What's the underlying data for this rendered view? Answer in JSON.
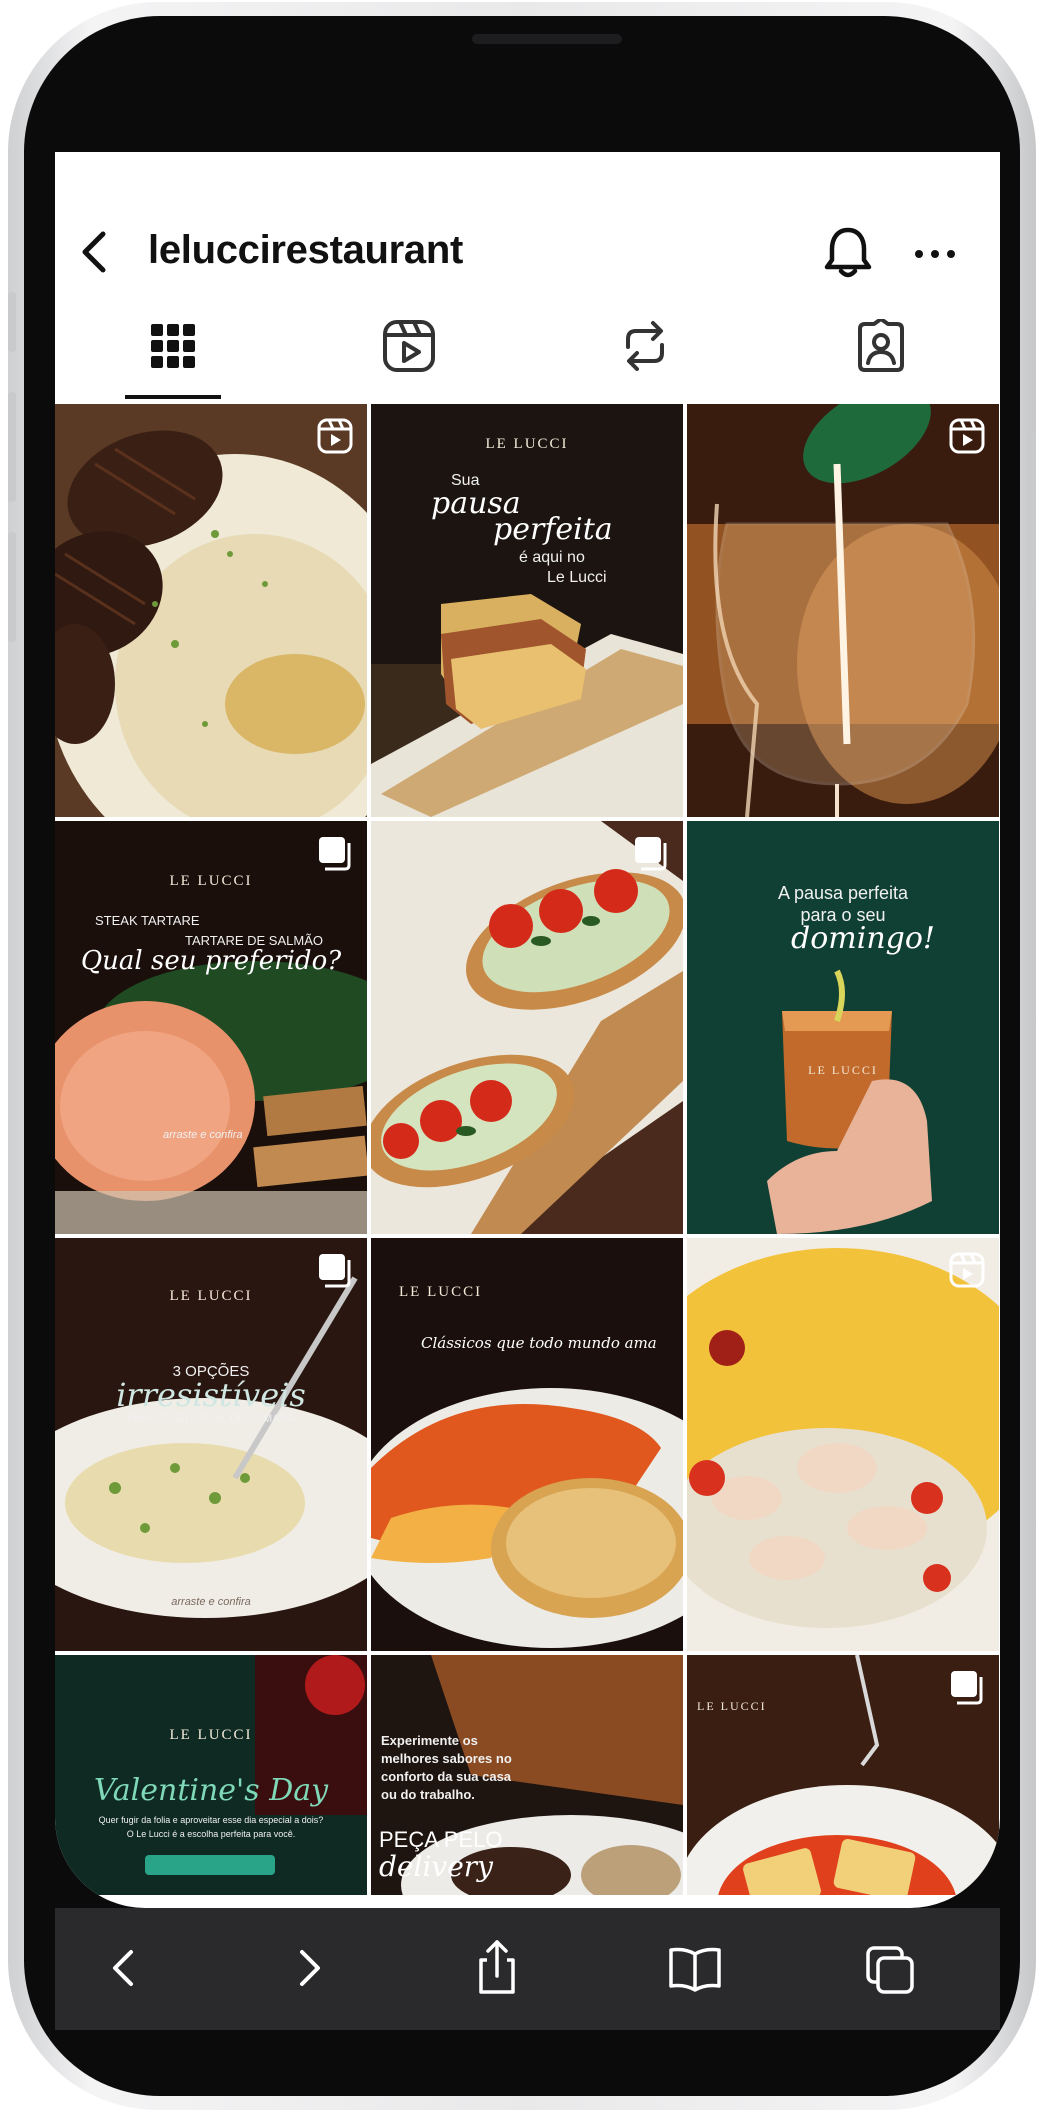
{
  "profile": {
    "username": "leluccirestaurant"
  },
  "icons": {
    "back": "chevron-left-icon",
    "bell": "bell-icon",
    "more": "more-horizontal-icon"
  },
  "tabs": [
    {
      "name": "posts-grid",
      "icon": "grid-icon",
      "selected": true
    },
    {
      "name": "reels",
      "icon": "reels-icon",
      "selected": false
    },
    {
      "name": "reposts",
      "icon": "repost-icon",
      "selected": false
    },
    {
      "name": "tagged",
      "icon": "tagged-icon",
      "selected": false
    }
  ],
  "posts": [
    {
      "type": "reel",
      "subject": "steak with risotto"
    },
    {
      "type": "post",
      "brand": "LE LUCCI",
      "line1": "Sua",
      "line2": "pausa",
      "line3": "perfeita",
      "line4": "é aqui no",
      "line5": "Le Lucci"
    },
    {
      "type": "reel",
      "subject": "white wine pour"
    },
    {
      "type": "carousel",
      "brand": "LE LUCCI",
      "line1": "STEAK TARTARE",
      "line2": "TARTARE DE SALMÃO",
      "line3": "Qual seu preferido?",
      "line4": "arraste e confira"
    },
    {
      "type": "carousel",
      "subject": "bruschetta"
    },
    {
      "type": "post",
      "brand": "LE LUCCI",
      "line1": "A pausa perfeita",
      "line2": "para o seu",
      "line3": "domingo!"
    },
    {
      "type": "carousel",
      "brand": "LE LUCCI",
      "line1": "3 OPÇÕES",
      "line2": "irresistíveis",
      "line3": "PARA O SEU FINAL DE SEMANA",
      "line4": "arraste e confira"
    },
    {
      "type": "post",
      "brand": "LE LUCCI",
      "line1": "Clássicos que todo mundo ama"
    },
    {
      "type": "reel",
      "subject": "seafood on polenta"
    },
    {
      "type": "post",
      "brand": "LE LUCCI",
      "line1": "Valentine's Day",
      "line2": "Quer fugir da folia e aproveitar esse dia especial a dois?",
      "line3": "O Le Lucci é a escolha perfeita para você."
    },
    {
      "type": "post",
      "line1": "Experimente os",
      "line2": "melhores sabores no",
      "line3": "conforto da sua casa",
      "line4": "ou do trabalho.",
      "line5": "PEÇA PELO",
      "line6": "delivery"
    },
    {
      "type": "carousel",
      "brand": "LE LUCCI",
      "subject": "ravioli"
    }
  ],
  "toolbar": {
    "buttons": [
      "back-arrow-icon",
      "forward-arrow-icon",
      "share-icon",
      "bookmarks-icon",
      "tabs-icon"
    ]
  },
  "colors": {
    "screen_bg": "#ffffff",
    "text": "#111111",
    "toolbar_bg": "#2a2a2c",
    "toolbar_icon": "#ffffff"
  }
}
